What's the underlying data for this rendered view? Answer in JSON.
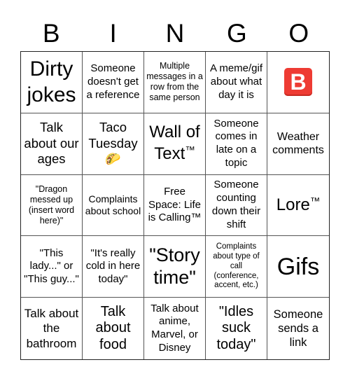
{
  "header": {
    "letters": [
      "B",
      "I",
      "N",
      "G",
      "O"
    ]
  },
  "cells": [
    {
      "text": "Dirty jokes"
    },
    {
      "text": "Someone doesn't get a reference"
    },
    {
      "text": "Multiple messages in a row from the same person"
    },
    {
      "text": "A meme/gif about what day it is"
    },
    {
      "text": "",
      "icon": "b-button-icon",
      "glyph": "B"
    },
    {
      "text": "Talk about our ages"
    },
    {
      "text": "Taco Tuesday",
      "icon": "taco-icon",
      "glyph": "🌮"
    },
    {
      "text": "Wall of Text",
      "suffix": "™"
    },
    {
      "text": "Someone comes in late on a topic"
    },
    {
      "text": "Weather comments"
    },
    {
      "text": "\"Dragon messed up (insert word here)\""
    },
    {
      "text": "Complaints about school"
    },
    {
      "text": "Free Space: Life is Calling™"
    },
    {
      "text": "Someone counting down their shift"
    },
    {
      "text": "Lore",
      "suffix": "™"
    },
    {
      "text": "\"This lady...\" or \"This guy...\""
    },
    {
      "text": "\"It's really cold in here today\""
    },
    {
      "text": "\"Story time\""
    },
    {
      "text": "Complaints about type of call (conference, accent, etc.)"
    },
    {
      "text": "Gifs"
    },
    {
      "text": "Talk about the bathroom"
    },
    {
      "text": "Talk about food"
    },
    {
      "text": "Talk about anime, Marvel, or Disney"
    },
    {
      "text": "\"Idles suck today\""
    },
    {
      "text": "Someone sends a link"
    }
  ],
  "colors": {
    "b_button": "#ee3b33",
    "grid_line": "#555555"
  }
}
